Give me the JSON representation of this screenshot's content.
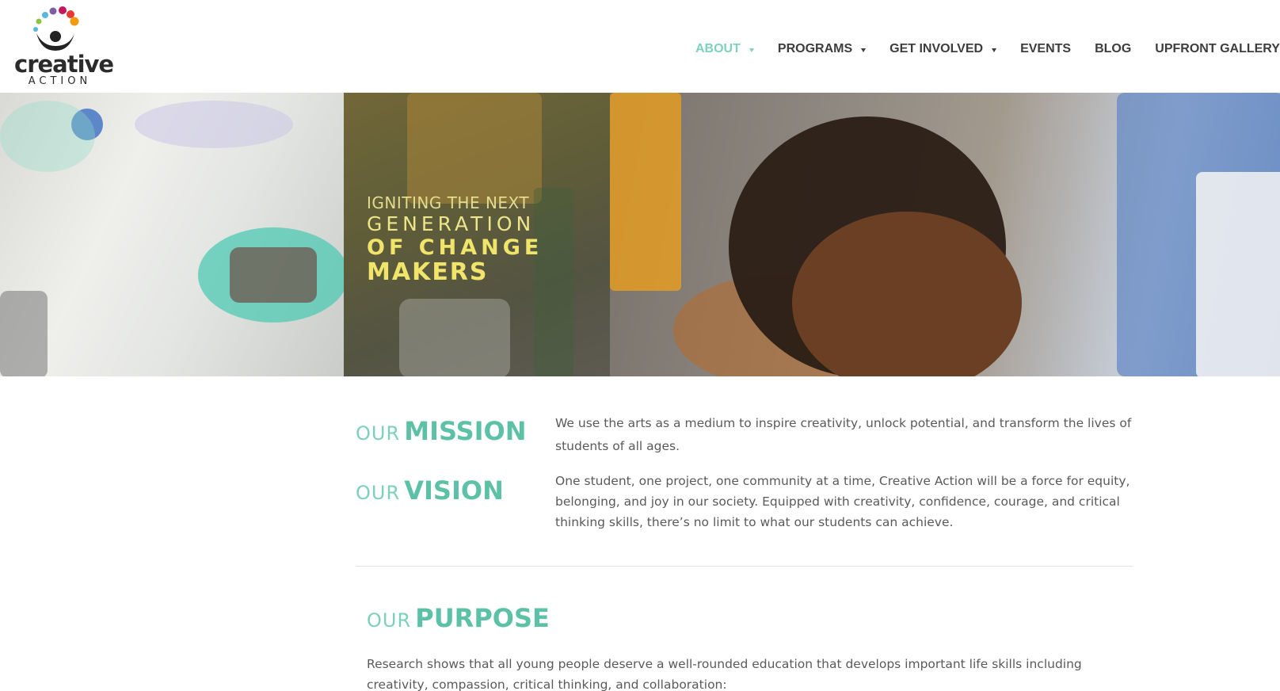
{
  "brand": {
    "name": "creative",
    "sub": "ACTION",
    "dot_colors": [
      "#5ab7e0",
      "#8cc63f",
      "#7b5ea7",
      "#c2185b",
      "#e53935",
      "#f39c12",
      "#f1c40f",
      "#1abc9c"
    ]
  },
  "nav": {
    "items": [
      {
        "label": "ABOUT",
        "has_dropdown": true,
        "active": true
      },
      {
        "label": "PROGRAMS",
        "has_dropdown": true
      },
      {
        "label": "GET INVOLVED",
        "has_dropdown": true
      },
      {
        "label": "EVENTS",
        "has_dropdown": false
      },
      {
        "label": "BLOG",
        "has_dropdown": false
      },
      {
        "label": "UPFRONT GALLERY",
        "has_dropdown": false
      }
    ]
  },
  "hero": {
    "line1": "IGNITING THE NEXT",
    "line2": "GENERATION",
    "line3": "OF CHANGE",
    "line4": "MAKERS"
  },
  "mission": {
    "our": "OUR",
    "title": "MISSION",
    "text": "We use the arts as a medium to inspire creativity, unlock potential, and transform the lives of students of all ages."
  },
  "vision": {
    "our": "OUR",
    "title": "VISION",
    "text": "One student, one project, one community at a time, Creative Action will be a force for equity, belonging, and joy in our society. Equipped with creativity, confidence, courage, and critical thinking skills, there’s no limit to what our students can achieve."
  },
  "purpose": {
    "our": "OUR",
    "title": "PURPOSE",
    "text": "Research shows that all young people deserve a well-rounded education that develops important life skills including creativity, compassion, critical thinking, and collaboration:"
  },
  "colors": {
    "accent": "#5cc1a6",
    "nav_active": "#7fd1bd",
    "hero_text": "#f0e46a"
  }
}
